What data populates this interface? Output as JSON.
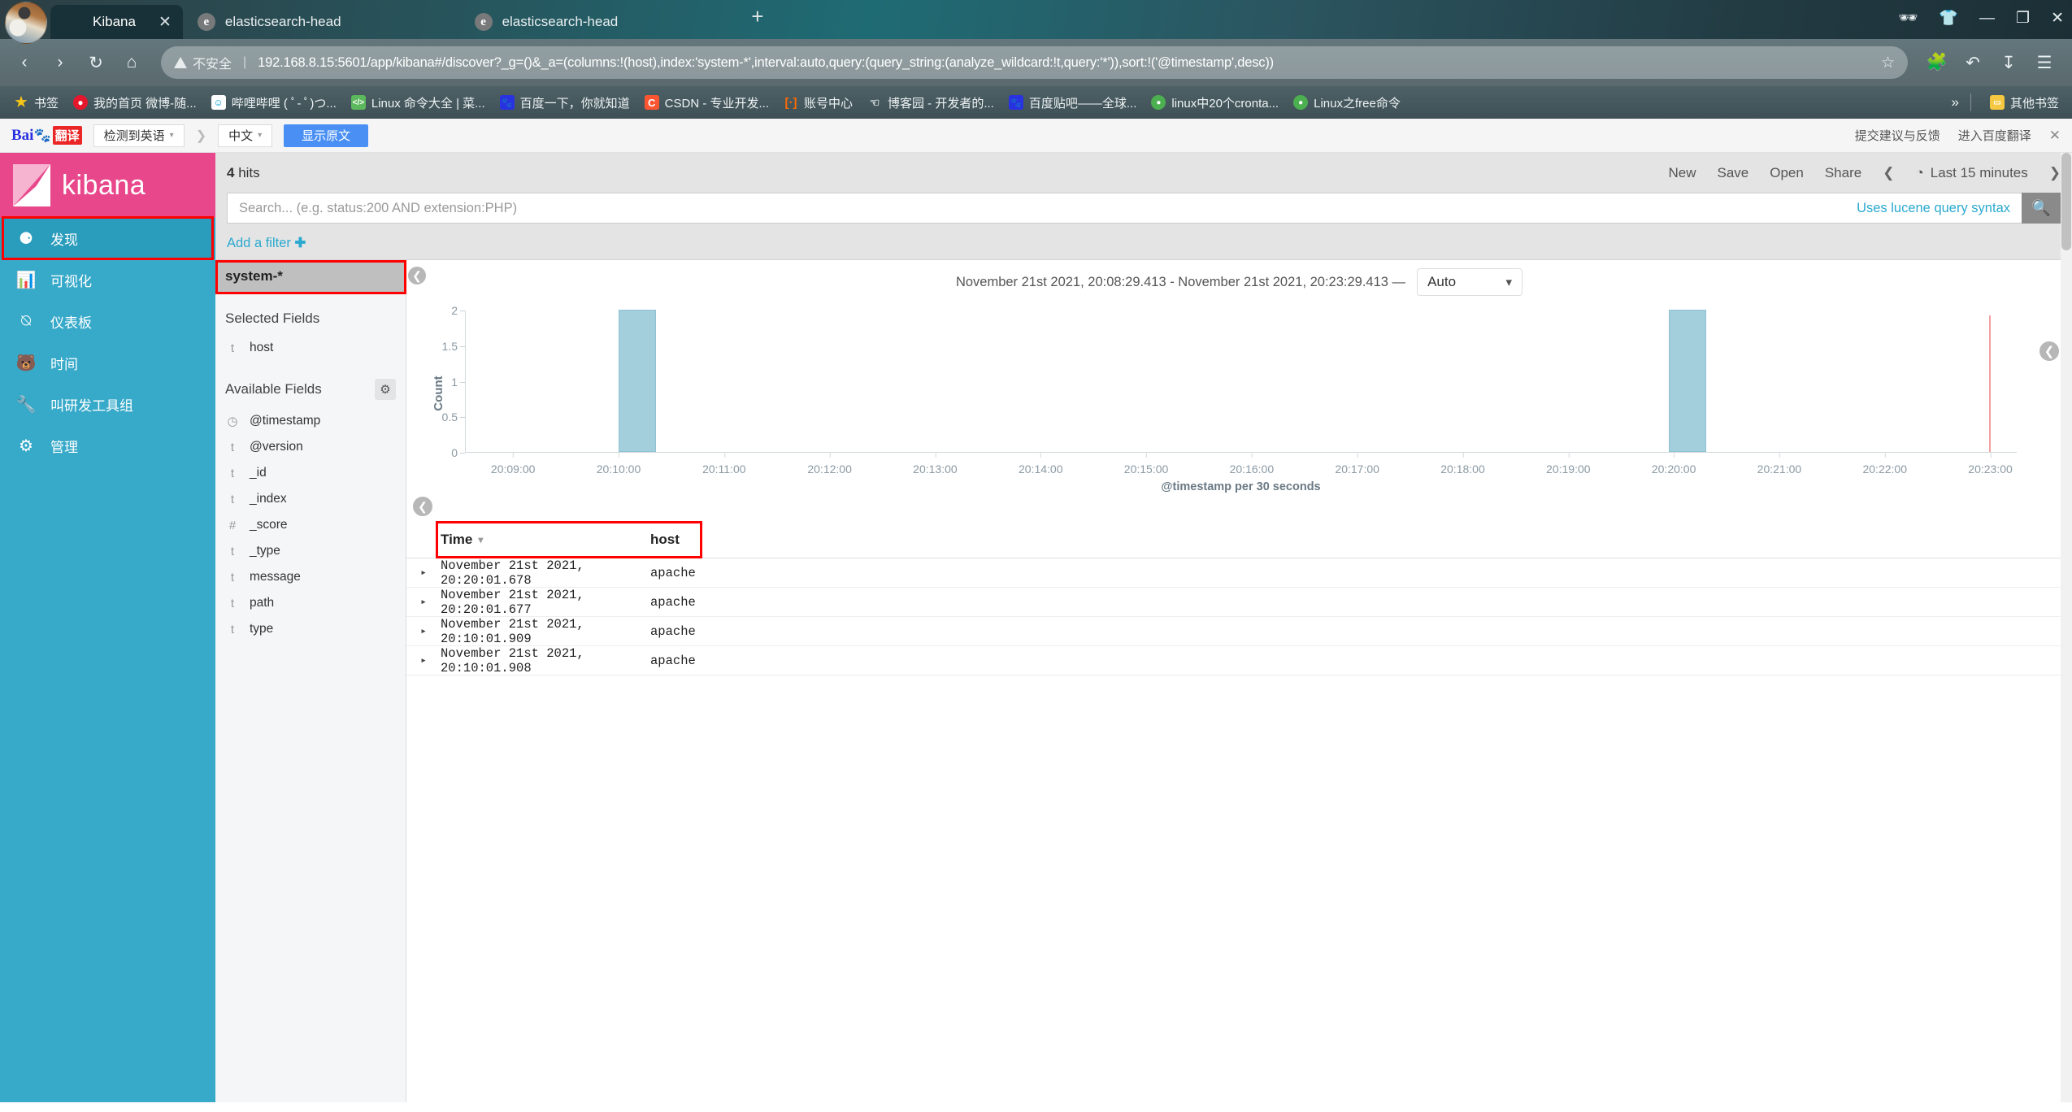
{
  "browser": {
    "tabs": [
      {
        "title": "Kibana",
        "favicon": "kibana-icon",
        "active": true,
        "close": "✕"
      },
      {
        "title": "elasticsearch-head",
        "favicon": "elasticsearch-icon",
        "active": false
      },
      {
        "title": "elasticsearch-head",
        "favicon": "elasticsearch-icon",
        "active": false
      }
    ],
    "new_tab_label": "+",
    "window_controls": [
      "incognito-icon",
      "profile-icon",
      "minimize-icon",
      "restore-icon",
      "close-icon"
    ],
    "nav": {
      "back": "‹",
      "forward": "›",
      "reload": "↻",
      "home": "⌂",
      "security_label": "不安全",
      "url": "192.168.8.15:5601/app/kibana#/discover?_g=()&_a=(columns:!(host),index:'system-*',interval:auto,query:(query_string:(analyze_wildcard:!t,query:'*')),sort:!('@timestamp',desc))",
      "star": "☆",
      "right_icons": [
        "extensions-icon",
        "undo-icon",
        "download-icon",
        "menu-icon"
      ]
    },
    "bookmarks": [
      {
        "label": "书签",
        "icon": "star-icon",
        "color": "#f5c518"
      },
      {
        "label": "我的首页 微博-随...",
        "icon": "weibo-icon",
        "color": "#e6162d"
      },
      {
        "label": "哔哩哔哩 ( ﾟ- ﾟ)つ...",
        "icon": "bilibili-icon",
        "color": "#00a1d6"
      },
      {
        "label": "Linux 命令大全 | 菜...",
        "icon": "runoob-icon",
        "color": "#5cb85c"
      },
      {
        "label": "百度一下，你就知道",
        "icon": "baidu-icon",
        "color": "#2932e1"
      },
      {
        "label": "CSDN - 专业开发...",
        "icon": "csdn-icon",
        "color": "#fc5531"
      },
      {
        "label": "账号中心",
        "icon": "account-icon",
        "color": "#ff6a00"
      },
      {
        "label": "博客园 - 开发者的...",
        "icon": "cnblogs-icon",
        "color": "#8f8f8f"
      },
      {
        "label": "百度贴吧——全球...",
        "icon": "tieba-icon",
        "color": "#2932e1"
      },
      {
        "label": "linux中20个cronta...",
        "icon": "qq-icon",
        "color": "#4caf50"
      },
      {
        "label": "Linux之free命令",
        "icon": "qq-icon",
        "color": "#4caf50"
      }
    ],
    "bookmarks_overflow": "»",
    "other_bookmarks": {
      "label": "其他书签",
      "icon": "folder-icon"
    }
  },
  "translate_bar": {
    "logo_prefix": "Bai",
    "logo_paw": "···",
    "logo_suffix": "翻译",
    "source_lang": "检测到英语",
    "arrow": "❯",
    "target_lang": "中文",
    "show_original": "显示原文",
    "feedback": "提交建议与反馈",
    "enter_baidu": "进入百度翻译",
    "close": "✕"
  },
  "kibana": {
    "logo_text": "kibana",
    "sidebar": [
      {
        "label": "发现",
        "icon": "compass-icon",
        "active": true
      },
      {
        "label": "可视化",
        "icon": "bar-chart-icon",
        "active": false
      },
      {
        "label": "仪表板",
        "icon": "dashboard-icon",
        "active": false
      },
      {
        "label": "时间",
        "icon": "timelion-icon",
        "active": false
      },
      {
        "label": "叫研发工具组",
        "icon": "wrench-icon",
        "active": false
      },
      {
        "label": "管理",
        "icon": "gear-icon",
        "active": false
      }
    ],
    "topbar": {
      "hits_count": "4",
      "hits_label": "hits",
      "menu": [
        "New",
        "Save",
        "Open",
        "Share"
      ],
      "prev_arrow": "❮",
      "next_arrow": "❯",
      "clock_icon": "◔",
      "time_range_label": "Last 15 minutes"
    },
    "search": {
      "placeholder": "Search... (e.g. status:200 AND extension:PHP)",
      "value": "",
      "lucene_hint": "Uses lucene query syntax",
      "search_icon": "🔍"
    },
    "add_filter": "Add a filter",
    "add_filter_plus": "✚",
    "index_pattern": "system-*",
    "selected_fields_title": "Selected Fields",
    "selected_fields": [
      {
        "name": "host",
        "type": "t"
      }
    ],
    "available_fields_title": "Available Fields",
    "available_fields": [
      {
        "name": "@timestamp",
        "type": "clock"
      },
      {
        "name": "@version",
        "type": "t"
      },
      {
        "name": "_id",
        "type": "t"
      },
      {
        "name": "_index",
        "type": "t"
      },
      {
        "name": "_score",
        "type": "#"
      },
      {
        "name": "_type",
        "type": "t"
      },
      {
        "name": "message",
        "type": "t"
      },
      {
        "name": "path",
        "type": "t"
      },
      {
        "name": "type",
        "type": "t"
      }
    ],
    "time_range_text": "November 21st 2021, 20:08:29.413 - November 21st 2021, 20:23:29.413 —",
    "interval_value": "Auto",
    "interval_caret": "⌄",
    "table": {
      "columns": [
        "Time",
        "host"
      ],
      "sort_caret": "▾",
      "expand_caret": "▸",
      "rows": [
        {
          "time": "November 21st 2021, 20:20:01.678",
          "host": "apache"
        },
        {
          "time": "November 21st 2021, 20:20:01.677",
          "host": "apache"
        },
        {
          "time": "November 21st 2021, 20:10:01.909",
          "host": "apache"
        },
        {
          "time": "November 21st 2021, 20:10:01.908",
          "host": "apache"
        }
      ]
    }
  },
  "chart_data": {
    "type": "bar",
    "title": "",
    "xlabel": "@timestamp per 30 seconds",
    "ylabel": "Count",
    "ylim": [
      0,
      2
    ],
    "yticks": [
      "0",
      "0.5",
      "1",
      "1.5",
      "2"
    ],
    "xticks": [
      "20:09:00",
      "20:10:00",
      "20:11:00",
      "20:12:00",
      "20:13:00",
      "20:14:00",
      "20:15:00",
      "20:16:00",
      "20:17:00",
      "20:18:00",
      "20:19:00",
      "20:20:00",
      "20:21:00",
      "20:22:00",
      "20:23:00"
    ],
    "categories": [
      "20:10:00",
      "20:20:00"
    ],
    "values": [
      2,
      2
    ],
    "bar_color": "#a3cfdd",
    "now_marker_color": "#f3a0a0",
    "grid": false,
    "legend": "none"
  }
}
